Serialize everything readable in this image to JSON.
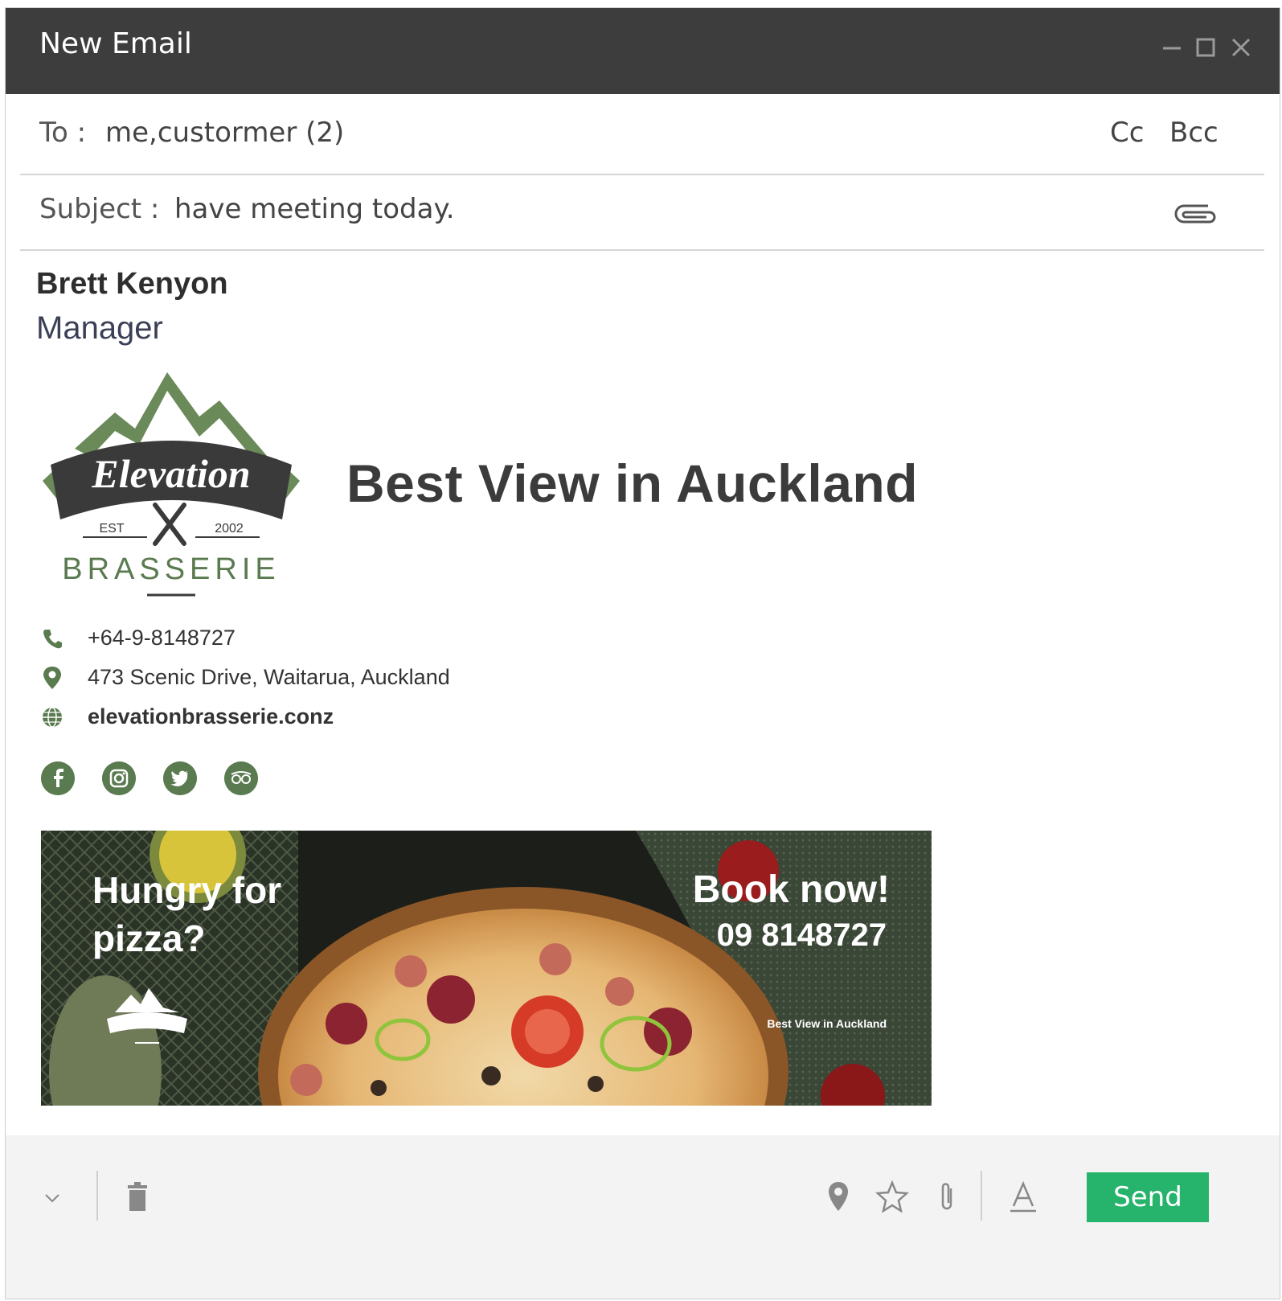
{
  "window": {
    "title": "New Email"
  },
  "to": {
    "label": "To :",
    "value": "me,custormer (2)",
    "cc_label": "Cc",
    "bcc_label": "Bcc"
  },
  "subject": {
    "label": "Subject :",
    "value": "have meeting today."
  },
  "signature": {
    "name": "Brett Kenyon",
    "role": "Manager",
    "tagline": "Best View in Auckland",
    "logo": {
      "name": "Elevation",
      "est": "EST",
      "year": "2002",
      "subtitle": "BRASSERIE"
    },
    "phone": "+64-9-8148727",
    "address": "473 Scenic Drive, Waitarua, Auckland",
    "website": "elevationbrasserie.conz",
    "social_icons": [
      "facebook-icon",
      "instagram-icon",
      "twitter-icon",
      "tripadvisor-icon"
    ],
    "brand_color": "#5a7a50"
  },
  "banner": {
    "headline": "Hungry for pizza?",
    "cta": "Book now!",
    "phone": "09 8148727",
    "tag": "Best View in Auckland"
  },
  "toolbar": {
    "send_label": "Send",
    "send_color": "#26b36b",
    "icons": [
      "chevron-down-icon",
      "trash-icon",
      "location-icon",
      "star-icon",
      "paperclip-icon",
      "text-format-icon"
    ]
  }
}
